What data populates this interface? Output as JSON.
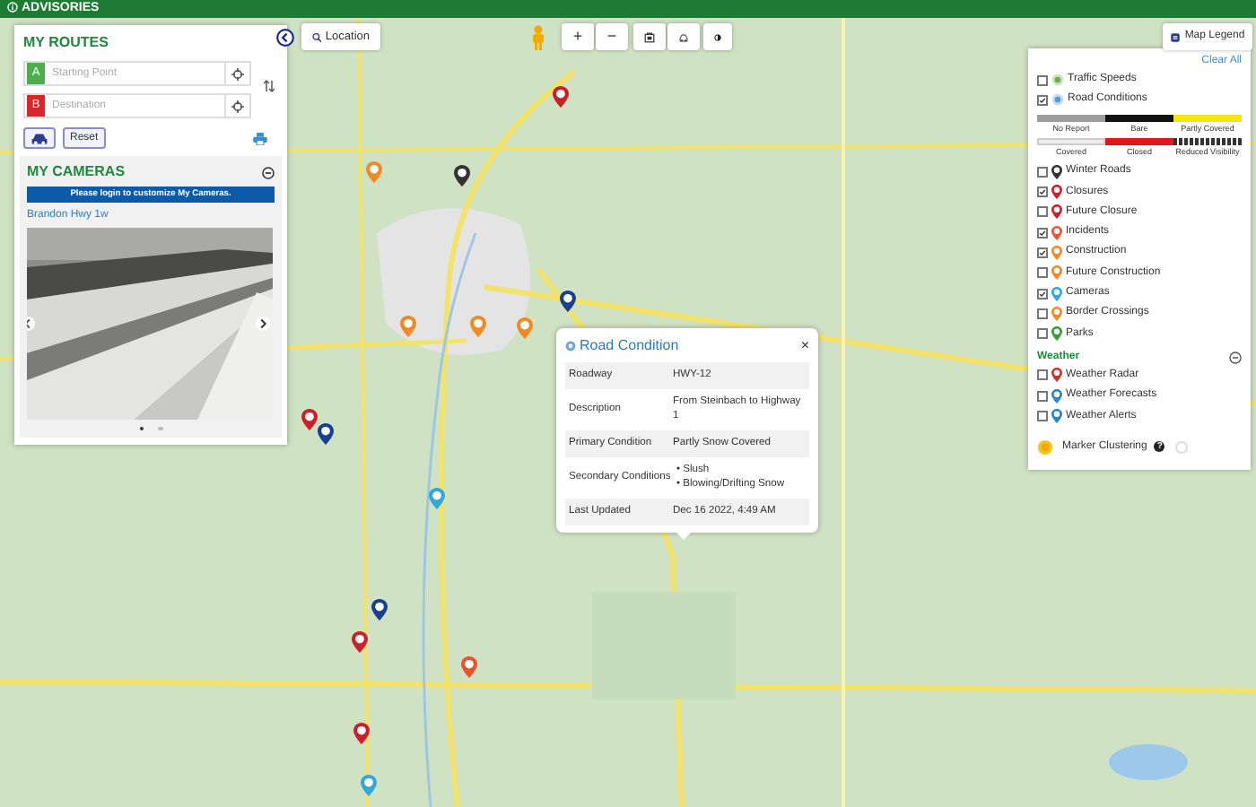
{
  "top_bar": {
    "label": "ADVISORIES"
  },
  "routes": {
    "title": "MY ROUTES",
    "fields": [
      {
        "marker": "A",
        "placeholder": "Starting Point",
        "color": "#4cae4c"
      },
      {
        "marker": "B",
        "placeholder": "Destination",
        "color": "#d9262c"
      }
    ],
    "reset": "Reset"
  },
  "cameras": {
    "title": "MY CAMERAS",
    "notice": "Please login to customize My Cameras.",
    "camera_name": "Brandon Hwy 1w",
    "slides": [
      {
        "selected": true
      },
      {
        "selected": false
      }
    ]
  },
  "toolbar": {
    "location": "Location",
    "zoom_in": "+",
    "zoom_out": "−"
  },
  "legend_button": "Map Legend",
  "legend": {
    "clear_all": "Clear All",
    "items": [
      {
        "label": "Traffic Speeds",
        "checked": false,
        "kind": "dot",
        "color": "#6ab04c"
      },
      {
        "label": "Road Conditions",
        "checked": true,
        "kind": "dot",
        "color": "#5b9bd5"
      },
      {
        "kind": "scale",
        "bands": [
          {
            "label": "No Report",
            "color": "#9e9e9e",
            "kind": "solid"
          },
          {
            "label": "Bare",
            "color": "#111111",
            "kind": "solid"
          },
          {
            "label": "Partly Covered",
            "color": "#f5e700",
            "kind": "solid"
          }
        ]
      },
      {
        "kind": "scale",
        "bands": [
          {
            "label": "Covered",
            "color": "#eeeeee",
            "kind": "solid"
          },
          {
            "label": "Closed",
            "color": "#e3161b",
            "kind": "solid"
          },
          {
            "label": "Reduced Visibility",
            "color": "#333333",
            "kind": "dashed"
          }
        ]
      },
      {
        "label": "Winter Roads",
        "checked": false,
        "kind": "pin",
        "color": "#333333"
      },
      {
        "label": "Closures",
        "checked": true,
        "kind": "pin",
        "color": "#c9202a"
      },
      {
        "label": "Future Closure",
        "checked": false,
        "kind": "pin",
        "color": "#c9202a"
      },
      {
        "label": "Incidents",
        "checked": true,
        "kind": "pin",
        "color": "#e8542c"
      },
      {
        "label": "Construction",
        "checked": true,
        "kind": "pin",
        "color": "#f08a24"
      },
      {
        "label": "Future Construction",
        "checked": false,
        "kind": "pin",
        "color": "#f08a24"
      },
      {
        "label": "Cameras",
        "checked": true,
        "kind": "pin",
        "color": "#31a9d8"
      },
      {
        "label": "Border Crossings",
        "checked": false,
        "kind": "pin",
        "color": "#f08a24"
      },
      {
        "label": "Parks",
        "checked": false,
        "kind": "pin",
        "color": "#3a9a3a"
      }
    ],
    "weather_title": "Weather",
    "weather_items": [
      {
        "label": "Weather Radar",
        "checked": false,
        "color": "#c0392b"
      },
      {
        "label": "Weather Forecasts",
        "checked": false,
        "color": "#2e86c1"
      },
      {
        "label": "Weather Alerts",
        "checked": false,
        "color": "#2e86c1"
      }
    ],
    "clustering": {
      "label": "Marker Clustering",
      "help": "?",
      "on": false
    }
  },
  "popup": {
    "title": "Road Condition",
    "close": "×",
    "rows": [
      {
        "label": "Roadway",
        "values": [
          "HWY-12"
        ],
        "kind": "text"
      },
      {
        "label": "Description",
        "values": [
          "From Steinbach to Highway 1"
        ],
        "kind": "text"
      },
      {
        "label": "Primary Condition",
        "values": [
          "Partly Snow Covered"
        ],
        "kind": "text"
      },
      {
        "label": "Secondary Conditions",
        "values": [
          "Slush",
          "Blowing/Drifting Snow"
        ],
        "kind": "list",
        "bullet": "•"
      },
      {
        "label": "Last Updated",
        "values": [
          "Dec 16 2022, 4:49 AM"
        ],
        "kind": "text"
      }
    ]
  }
}
